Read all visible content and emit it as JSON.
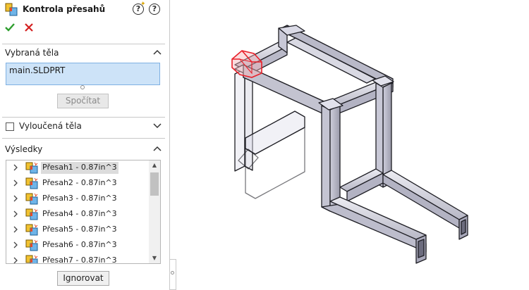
{
  "header": {
    "title": "Kontrola přesahů",
    "help_glyph": "?",
    "feature_icon": "interference-check-icon"
  },
  "actions": {
    "ok_icon": "checkmark-icon",
    "cancel_icon": "close-icon"
  },
  "selected_bodies": {
    "heading": "Vybraná těla",
    "value": "main.SLDPRT",
    "calculate_label": "Spočítat"
  },
  "excluded_bodies": {
    "heading": "Vyloučená těla"
  },
  "results": {
    "heading": "Výsledky",
    "items": [
      {
        "label": "Přesah1 - 0.87in^3"
      },
      {
        "label": "Přesah2 - 0.87in^3"
      },
      {
        "label": "Přesah3 - 0.87in^3"
      },
      {
        "label": "Přesah4 - 0.87in^3"
      },
      {
        "label": "Přesah5 - 0.87in^3"
      },
      {
        "label": "Přesah6 - 0.87in^3"
      },
      {
        "label": "Přesah7 - 0.87in^3"
      }
    ],
    "ignore_label": "Ignorovat"
  },
  "colors": {
    "accent_field": "#cde3f8",
    "ok_green": "#2e9e2e",
    "cancel_red": "#d42020",
    "interference_red": "#e8202a"
  }
}
